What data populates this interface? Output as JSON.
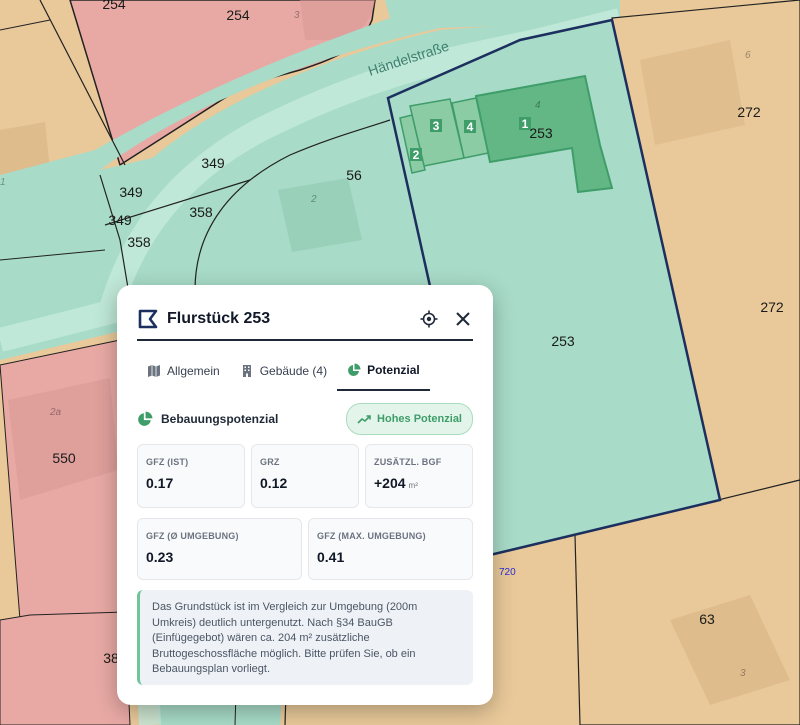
{
  "map": {
    "street_name": "Händelstraße",
    "parcel_labels": [
      "254",
      "254",
      "349",
      "349",
      "349",
      "358",
      "358",
      "56",
      "253",
      "253",
      "272",
      "272",
      "550",
      "38",
      "63"
    ],
    "house_numbers": [
      "3",
      "2",
      "4",
      "6",
      "1",
      "2a",
      "3"
    ],
    "building_numbers": [
      "1",
      "2",
      "3",
      "4"
    ],
    "boundary_label": "720"
  },
  "panel": {
    "title": "Flurstück 253",
    "icons": {
      "title": "parcel-icon",
      "locate": "crosshair-icon",
      "close": "close-icon"
    },
    "tabs": [
      {
        "label": "Allgemein",
        "icon": "map-icon",
        "active": false
      },
      {
        "label": "Gebäude (4)",
        "icon": "building-icon",
        "active": false
      },
      {
        "label": "Potenzial",
        "icon": "pie-chart-icon",
        "active": true
      }
    ],
    "section_title": "Bebauungspotenzial",
    "badge": "Hohes Potenzial",
    "metrics_row1": [
      {
        "label": "GFZ (IST)",
        "value": "0.17",
        "unit": ""
      },
      {
        "label": "GRZ",
        "value": "0.12",
        "unit": ""
      },
      {
        "label": "ZUSÄTZL. BGF",
        "value": "+204",
        "unit": "m²"
      }
    ],
    "metrics_row2": [
      {
        "label": "GFZ (Ø UMGEBUNG)",
        "value": "0.23",
        "unit": ""
      },
      {
        "label": "GFZ (MAX. UMGEBUNG)",
        "value": "0.41",
        "unit": ""
      }
    ],
    "note": "Das Grundstück ist im Vergleich zur Umgebung (200m Umkreis) deutlich untergenutzt. Nach §34 BauGB (Einfügegebot) wären ca. 204 m² zusätzliche Bruttogeschossfläche möglich. Bitte prüfen Sie, ob ein Bebauungsplan vorliegt.",
    "colors": {
      "accent": "#3f9d6a",
      "badge_bg": "#e3f5ea",
      "dark": "#1f2937"
    }
  }
}
